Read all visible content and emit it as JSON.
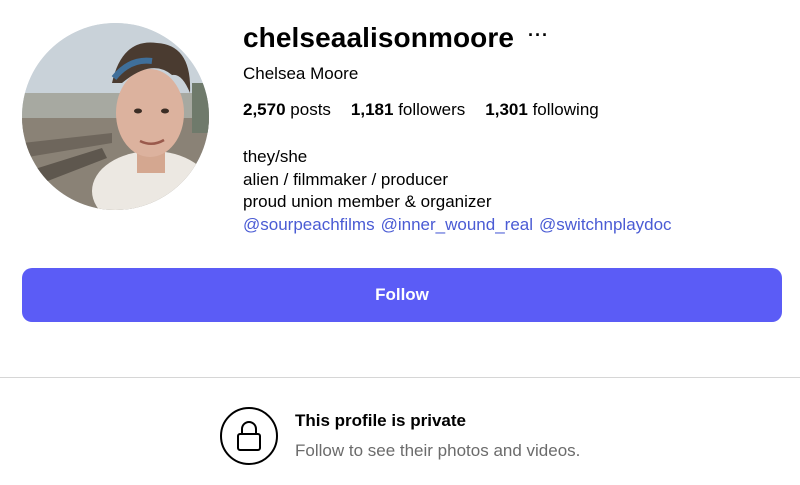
{
  "profile": {
    "username": "chelseaalisonmoore",
    "more_label": "···",
    "full_name": "Chelsea Moore",
    "avatar_icon": "profile-photo"
  },
  "stats": [
    {
      "count": "2,570",
      "label": "posts"
    },
    {
      "count": "1,181",
      "label": "followers"
    },
    {
      "count": "1,301",
      "label": "following"
    }
  ],
  "bio": {
    "lines": [
      "they/she",
      "alien / filmmaker / producer",
      "proud union member & organizer"
    ],
    "mentions": [
      "@sourpeachfilms",
      "@inner_wound_real",
      "@switchnplaydoc"
    ]
  },
  "follow_button": {
    "label": "Follow",
    "color": "#5b5cf6"
  },
  "private_notice": {
    "icon": "lock-icon",
    "title": "This profile is private",
    "subtitle": "Follow to see their photos and videos."
  },
  "colors": {
    "link": "#4a5bd4",
    "muted": "#6b6b6b"
  }
}
